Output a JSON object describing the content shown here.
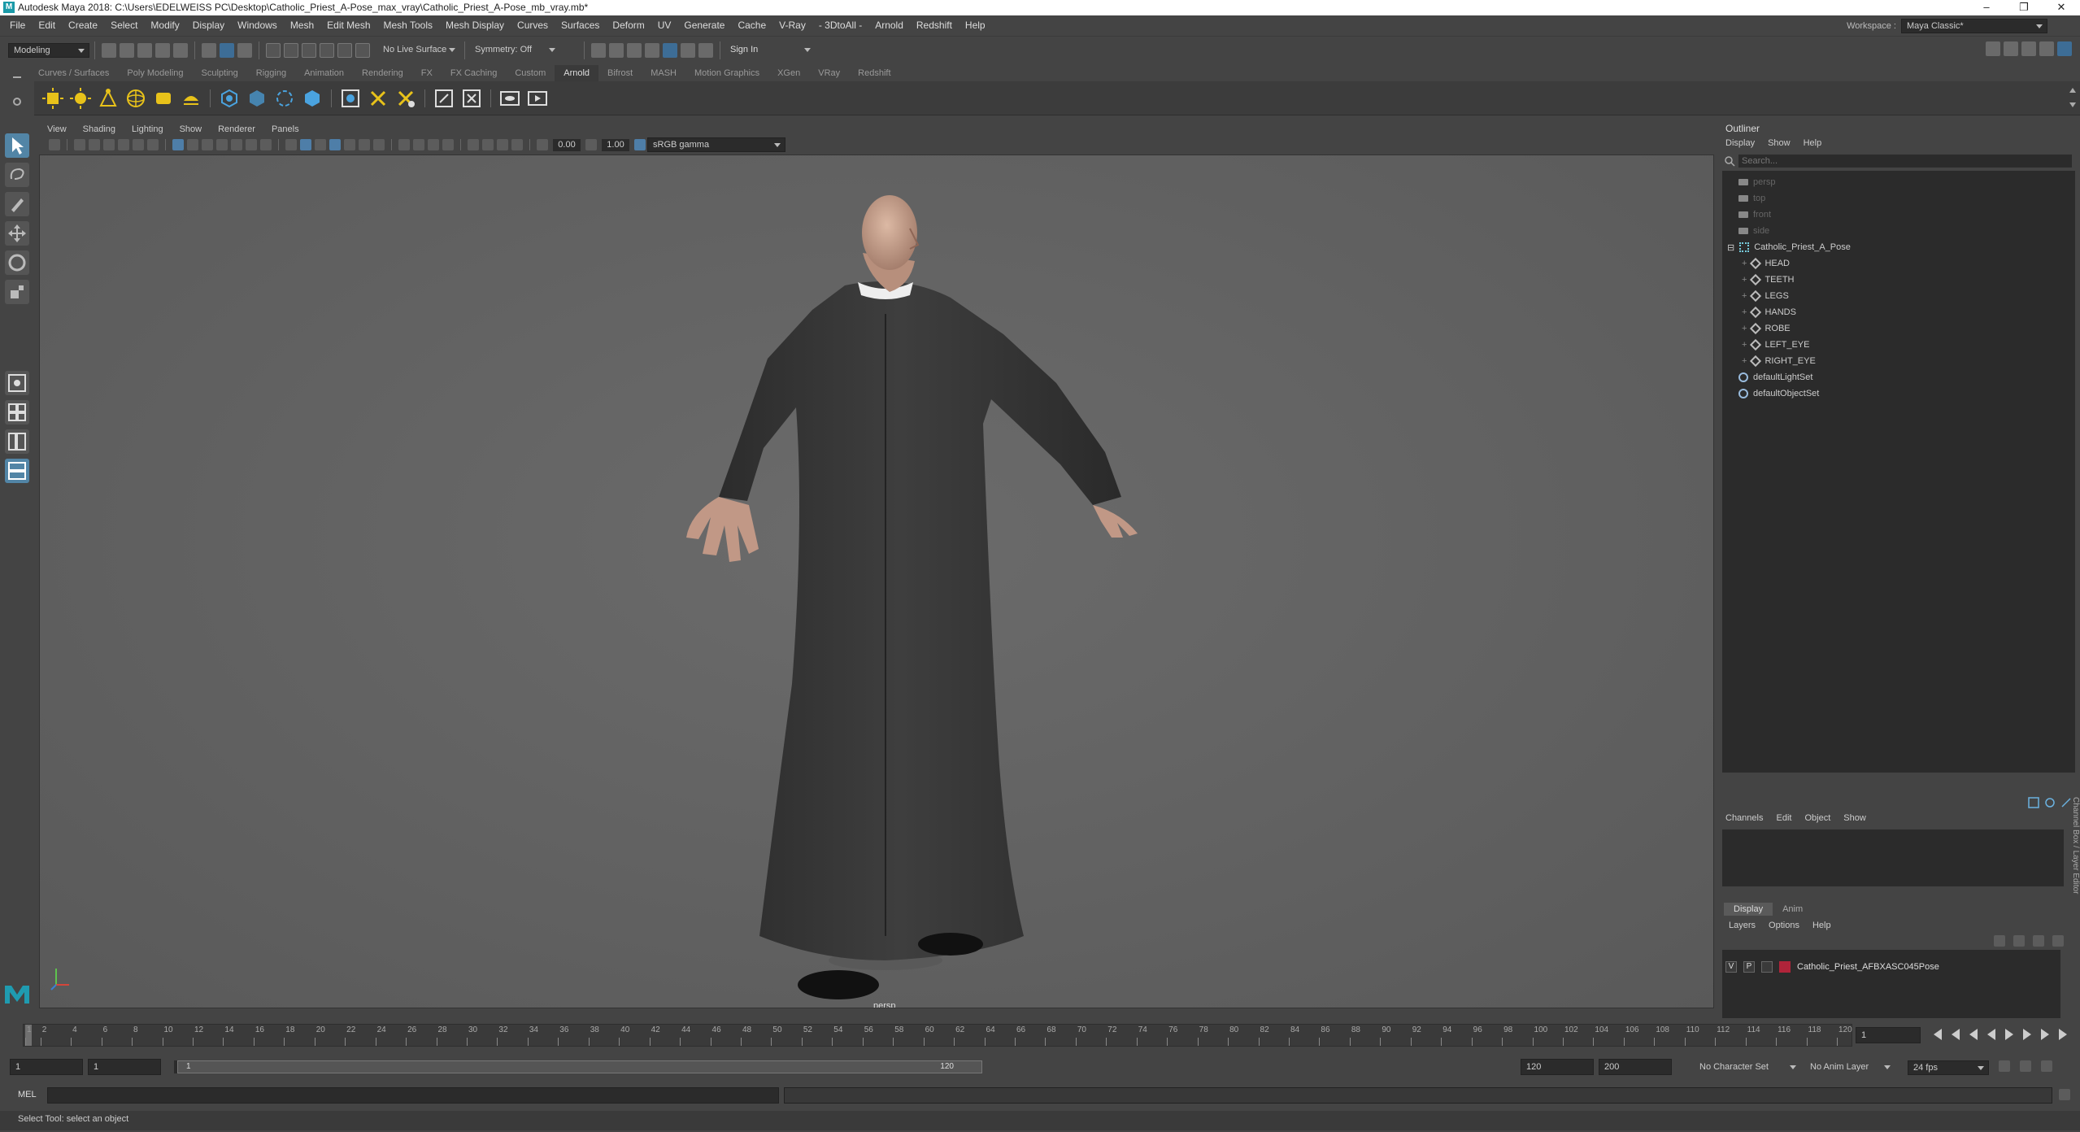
{
  "window": {
    "title": "Autodesk Maya 2018: C:\\Users\\EDELWEISS PC\\Desktop\\Catholic_Priest_A-Pose_max_vray\\Catholic_Priest_A-Pose_mb_vray.mb*",
    "logo": "M",
    "minimize": "–",
    "maximize": "❐",
    "close": "✕"
  },
  "menubar": {
    "items": [
      "File",
      "Edit",
      "Create",
      "Select",
      "Modify",
      "Display",
      "Windows",
      "Mesh",
      "Edit Mesh",
      "Mesh Tools",
      "Mesh Display",
      "Curves",
      "Surfaces",
      "Deform",
      "UV",
      "Generate",
      "Cache",
      "V-Ray",
      "- 3DtoAll -",
      "Arnold",
      "Redshift",
      "Help"
    ],
    "workspace_label": "Workspace :",
    "workspace_value": "Maya Classic*"
  },
  "statusline": {
    "mode": "Modeling",
    "live_surface": "No Live Surface",
    "symmetry": "Symmetry: Off",
    "sign_in": "Sign In"
  },
  "shelf_tabs": [
    "Curves / Surfaces",
    "Poly Modeling",
    "Sculpting",
    "Rigging",
    "Animation",
    "Rendering",
    "FX",
    "FX Caching",
    "Custom",
    "Arnold",
    "Bifrost",
    "MASH",
    "Motion Graphics",
    "XGen",
    "VRay",
    "Redshift"
  ],
  "shelf_active": "Arnold",
  "viewport": {
    "menu": [
      "View",
      "Shading",
      "Lighting",
      "Show",
      "Renderer",
      "Panels"
    ],
    "exposure": "0.00",
    "gamma": "1.00",
    "color_space": "sRGB gamma",
    "camera_label": "persp"
  },
  "outliner": {
    "title": "Outliner",
    "menu": [
      "Display",
      "Show",
      "Help"
    ],
    "search_placeholder": "Search...",
    "items": [
      {
        "label": "persp",
        "type": "camera",
        "indent": 0,
        "dim": true
      },
      {
        "label": "top",
        "type": "camera",
        "indent": 0,
        "dim": true
      },
      {
        "label": "front",
        "type": "camera",
        "indent": 0,
        "dim": true
      },
      {
        "label": "side",
        "type": "camera",
        "indent": 0,
        "dim": true
      },
      {
        "label": "Catholic_Priest_A_Pose",
        "type": "group",
        "indent": 0,
        "dim": false,
        "expanded": true
      },
      {
        "label": "HEAD",
        "type": "mesh",
        "indent": 1,
        "dim": false
      },
      {
        "label": "TEETH",
        "type": "mesh",
        "indent": 1,
        "dim": false
      },
      {
        "label": "LEGS",
        "type": "mesh",
        "indent": 1,
        "dim": false
      },
      {
        "label": "HANDS",
        "type": "mesh",
        "indent": 1,
        "dim": false
      },
      {
        "label": "ROBE",
        "type": "mesh",
        "indent": 1,
        "dim": false
      },
      {
        "label": "LEFT_EYE",
        "type": "mesh",
        "indent": 1,
        "dim": false
      },
      {
        "label": "RIGHT_EYE",
        "type": "mesh",
        "indent": 1,
        "dim": false
      },
      {
        "label": "defaultLightSet",
        "type": "set",
        "indent": 0,
        "dim": false
      },
      {
        "label": "defaultObjectSet",
        "type": "set",
        "indent": 0,
        "dim": false
      }
    ]
  },
  "channelbox": {
    "menu": [
      "Channels",
      "Edit",
      "Object",
      "Show"
    ],
    "side_label": "Channel Box / Layer Editor"
  },
  "layers": {
    "tabs": [
      "Display",
      "Anim"
    ],
    "active_tab": "Display",
    "menu": [
      "Layers",
      "Options",
      "Help"
    ],
    "layer": {
      "v": "V",
      "p": "P",
      "name": "Catholic_Priest_AFBXASC045Pose",
      "color": "#b0243a"
    }
  },
  "timeline": {
    "ticks": [
      "1",
      "2",
      "4",
      "6",
      "8",
      "10",
      "12",
      "14",
      "16",
      "18",
      "20",
      "22",
      "24",
      "26",
      "28",
      "30",
      "32",
      "34",
      "36",
      "38",
      "40",
      "42",
      "44",
      "46",
      "48",
      "50",
      "52",
      "54",
      "56",
      "58",
      "60",
      "62",
      "64",
      "66",
      "68",
      "70",
      "72",
      "74",
      "76",
      "78",
      "80",
      "82",
      "84",
      "86",
      "88",
      "90",
      "92",
      "94",
      "96",
      "98",
      "100",
      "102",
      "104",
      "106",
      "108",
      "110",
      "112",
      "114",
      "116",
      "118",
      "120"
    ],
    "current_frame": "1"
  },
  "range": {
    "start": "1",
    "anim_start": "1",
    "range_start_label": "1",
    "range_end_label": "120",
    "end": "120",
    "anim_end": "200",
    "character_set": "No Character Set",
    "anim_layer": "No Anim Layer",
    "fps": "24 fps"
  },
  "cmdline": {
    "label": "MEL"
  },
  "helpline": {
    "text": "Select Tool: select an object"
  }
}
